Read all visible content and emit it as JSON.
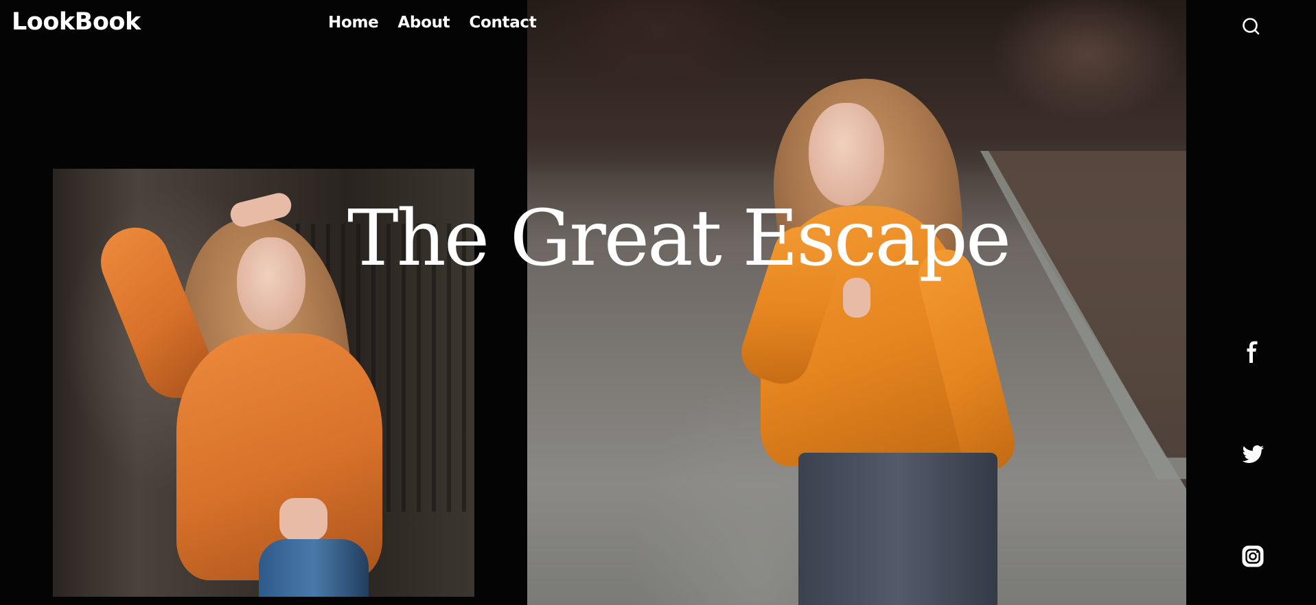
{
  "brand": {
    "logo": "LookBook"
  },
  "nav": {
    "items": [
      "Home",
      "About",
      "Contact"
    ]
  },
  "header": {
    "search_icon": "search-icon"
  },
  "hero": {
    "headline": "The Great Escape"
  },
  "social": {
    "icons": [
      "facebook-icon",
      "twitter-icon",
      "instagram-icon"
    ]
  },
  "colors": {
    "background": "#040404",
    "text": "#ffffff",
    "hoodie": "#e5851f"
  }
}
